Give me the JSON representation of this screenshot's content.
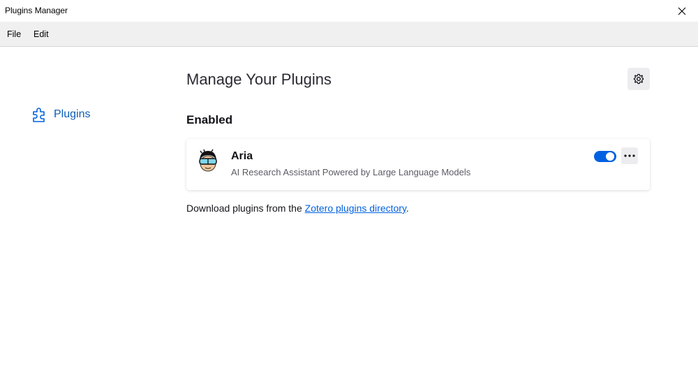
{
  "window": {
    "title": "Plugins Manager"
  },
  "menubar": {
    "items": [
      {
        "label": "File"
      },
      {
        "label": "Edit"
      }
    ]
  },
  "sidebar": {
    "items": [
      {
        "label": "Plugins",
        "icon": "puzzle-icon"
      }
    ]
  },
  "main": {
    "title": "Manage Your Plugins",
    "settings_icon": "gear-icon",
    "enabled_heading": "Enabled",
    "plugins": [
      {
        "name": "Aria",
        "description": "AI Research Assistant Powered by Large Language Models",
        "enabled": true,
        "icon": "aria-avatar-icon"
      }
    ],
    "footer": {
      "prefix": "Download plugins from the ",
      "link_text": "Zotero plugins directory",
      "suffix": "."
    }
  },
  "colors": {
    "accent": "#0061e0",
    "link": "#0a5fb8",
    "menubar_bg": "#f0f0f0"
  }
}
